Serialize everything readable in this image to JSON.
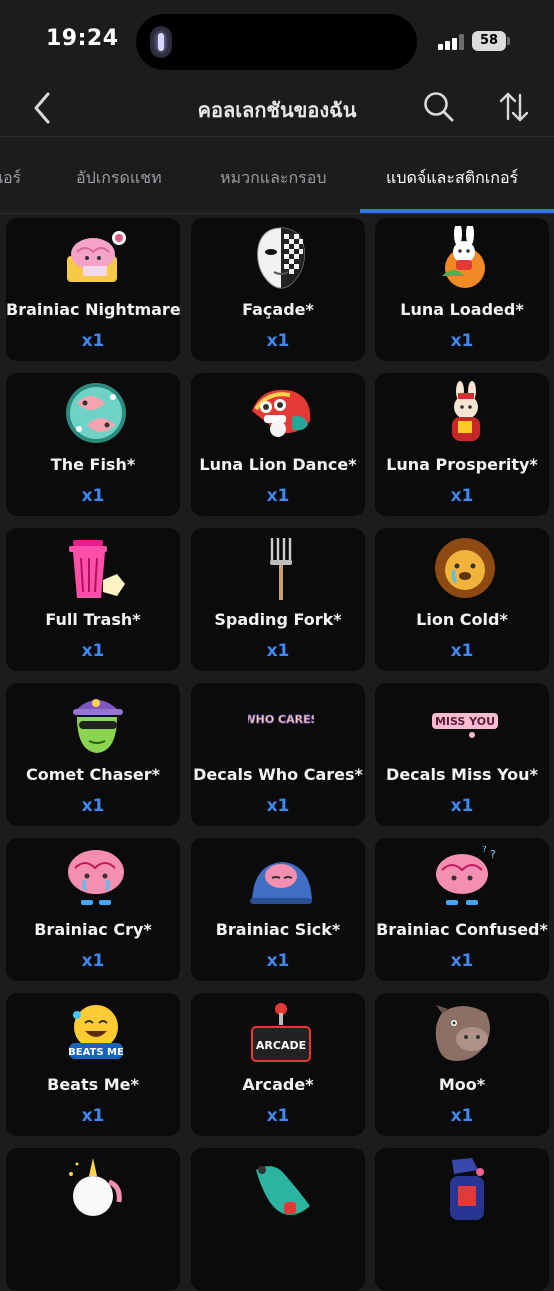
{
  "status_bar": {
    "time": "19:24",
    "battery": "58"
  },
  "nav": {
    "title": "คอลเลกชันของฉัน"
  },
  "tabs": [
    {
      "label": "นอร์"
    },
    {
      "label": "อัปเกรดแชท"
    },
    {
      "label": "หมวกและกรอบ"
    },
    {
      "label": "แบดจ์และสติกเกอร์"
    }
  ],
  "items": [
    {
      "name": "Brainiac Nightmare*",
      "qty": "x1",
      "icon": "brain-nightmare-icon"
    },
    {
      "name": "Façade*",
      "qty": "x1",
      "icon": "mask-icon"
    },
    {
      "name": "Luna Loaded*",
      "qty": "x1",
      "icon": "rabbit-loaded-icon"
    },
    {
      "name": "The Fish*",
      "qty": "x1",
      "icon": "fish-icon"
    },
    {
      "name": "Luna Lion Dance*",
      "qty": "x1",
      "icon": "lion-dance-icon"
    },
    {
      "name": "Luna Prosperity*",
      "qty": "x1",
      "icon": "rabbit-prosperity-icon"
    },
    {
      "name": "Full Trash*",
      "qty": "x1",
      "icon": "trash-icon"
    },
    {
      "name": "Spading Fork*",
      "qty": "x1",
      "icon": "fork-icon"
    },
    {
      "name": "Lion Cold*",
      "qty": "x1",
      "icon": "lion-cold-icon"
    },
    {
      "name": "Comet Chaser*",
      "qty": "x1",
      "icon": "alien-icon"
    },
    {
      "name": "Decals Who Cares*",
      "qty": "x1",
      "icon": "who-cares-decal-icon"
    },
    {
      "name": "Decals Miss You*",
      "qty": "x1",
      "icon": "miss-you-decal-icon"
    },
    {
      "name": "Brainiac Cry*",
      "qty": "x1",
      "icon": "brain-cry-icon"
    },
    {
      "name": "Brainiac Sick*",
      "qty": "x1",
      "icon": "brain-sick-icon"
    },
    {
      "name": "Brainiac Confused*",
      "qty": "x1",
      "icon": "brain-confused-icon"
    },
    {
      "name": "Beats Me*",
      "qty": "x1",
      "icon": "beats-me-emoji-icon"
    },
    {
      "name": "Arcade*",
      "qty": "x1",
      "icon": "arcade-icon"
    },
    {
      "name": "Moo*",
      "qty": "x1",
      "icon": "cow-icon"
    },
    {
      "name": "",
      "qty": "",
      "icon": "unicorn-icon"
    },
    {
      "name": "",
      "qty": "",
      "icon": "creature-icon"
    },
    {
      "name": "",
      "qty": "",
      "icon": "figure-icon"
    }
  ],
  "colors": {
    "accent": "#2f78e8",
    "qty": "#3f88f2",
    "background": "#1c1c1e",
    "card": "#0b0b0c"
  },
  "decals": {
    "who_cares": "WHO CARES",
    "miss_you": "MISS YOU",
    "beats_me": "BEATS ME",
    "arcade": "ARCADE"
  }
}
